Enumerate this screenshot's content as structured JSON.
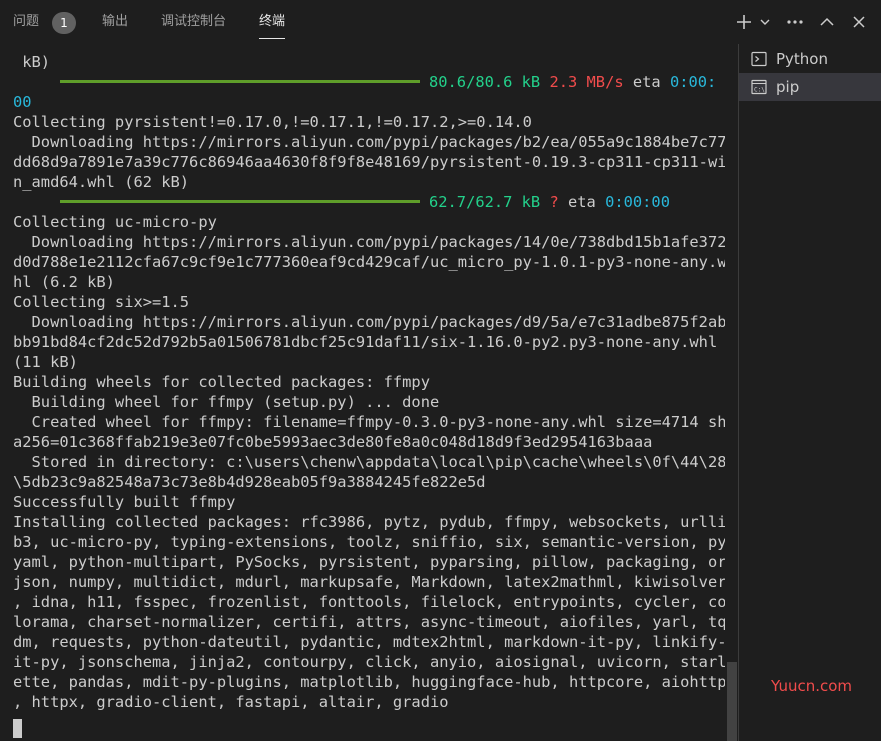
{
  "tabs": [
    {
      "label": "问题"
    },
    {
      "label": "输出"
    },
    {
      "label": "调试控制台"
    },
    {
      "label": "终端"
    }
  ],
  "problems_count": "1",
  "header_icons": {
    "new_terminal": "plus-icon",
    "dropdown": "chevron-down-icon",
    "more": "ellipsis-icon",
    "maximize": "chevron-up-icon",
    "close": "close-icon"
  },
  "terminal_lines": [
    {
      "segments": [
        {
          "text": " kB)"
        }
      ]
    },
    {
      "bar": true,
      "segments": [
        {
          "text": "80.6/80.6 kB ",
          "color": "green"
        },
        {
          "text": "2.3 MB/s",
          "color": "red"
        },
        {
          "text": " eta "
        },
        {
          "text": "0:00:",
          "color": "cyan"
        }
      ]
    },
    {
      "segments": [
        {
          "text": "00",
          "color": "cyan"
        }
      ]
    },
    {
      "segments": [
        {
          "text": "Collecting pyrsistent!=0.17.0,!=0.17.1,!=0.17.2,>=0.14.0"
        }
      ]
    },
    {
      "segments": [
        {
          "text": "  Downloading https://mirrors.aliyun.com/pypi/packages/b2/ea/055a9c1884be7c77"
        }
      ]
    },
    {
      "segments": [
        {
          "text": "dd68d9a7891e7a39c776c86946aa4630f8f9f8e48169/pyrsistent-0.19.3-cp311-cp311-wi"
        }
      ]
    },
    {
      "segments": [
        {
          "text": "n_amd64.whl (62 kB)"
        }
      ]
    },
    {
      "bar": true,
      "segments": [
        {
          "text": "62.7/62.7 kB ",
          "color": "green"
        },
        {
          "text": "?",
          "color": "red"
        },
        {
          "text": " eta "
        },
        {
          "text": "0:00:00",
          "color": "cyan"
        }
      ]
    },
    {
      "segments": [
        {
          "text": "Collecting uc-micro-py"
        }
      ]
    },
    {
      "segments": [
        {
          "text": "  Downloading https://mirrors.aliyun.com/pypi/packages/14/0e/738dbd15b1afe372"
        }
      ]
    },
    {
      "segments": [
        {
          "text": "d0d788e1e2112cfa67c9cf9e1c777360eaf9cd429caf/uc_micro_py-1.0.1-py3-none-any.w"
        }
      ]
    },
    {
      "segments": [
        {
          "text": "hl (6.2 kB)"
        }
      ]
    },
    {
      "segments": [
        {
          "text": "Collecting six>=1.5"
        }
      ]
    },
    {
      "segments": [
        {
          "text": "  Downloading https://mirrors.aliyun.com/pypi/packages/d9/5a/e7c31adbe875f2ab"
        }
      ]
    },
    {
      "segments": [
        {
          "text": "bb91bd84cf2dc52d792b5a01506781dbcf25c91daf11/six-1.16.0-py2.py3-none-any.whl"
        }
      ]
    },
    {
      "segments": [
        {
          "text": "(11 kB)"
        }
      ]
    },
    {
      "segments": [
        {
          "text": "Building wheels for collected packages: ffmpy"
        }
      ]
    },
    {
      "segments": [
        {
          "text": "  Building wheel for ffmpy (setup.py) ... done"
        }
      ]
    },
    {
      "segments": [
        {
          "text": "  Created wheel for ffmpy: filename=ffmpy-0.3.0-py3-none-any.whl size=4714 sh"
        }
      ]
    },
    {
      "segments": [
        {
          "text": "a256=01c368ffab219e3e07fc0be5993aec3de80fe8a0c048d18d9f3ed2954163baaa"
        }
      ]
    },
    {
      "segments": [
        {
          "text": "  Stored in directory: c:\\users\\chenw\\appdata\\local\\pip\\cache\\wheels\\0f\\44\\28"
        }
      ]
    },
    {
      "segments": [
        {
          "text": "\\5db23c9a82548a73c73e8b4d928eab05f9a3884245fe822e5d"
        }
      ]
    },
    {
      "segments": [
        {
          "text": "Successfully built ffmpy"
        }
      ]
    },
    {
      "segments": [
        {
          "text": "Installing collected packages: rfc3986, pytz, pydub, ffmpy, websockets, urlli"
        }
      ]
    },
    {
      "segments": [
        {
          "text": "b3, uc-micro-py, typing-extensions, toolz, sniffio, six, semantic-version, py"
        }
      ]
    },
    {
      "segments": [
        {
          "text": "yaml, python-multipart, PySocks, pyrsistent, pyparsing, pillow, packaging, or"
        }
      ]
    },
    {
      "segments": [
        {
          "text": "json, numpy, multidict, mdurl, markupsafe, Markdown, latex2mathml, kiwisolver"
        }
      ]
    },
    {
      "segments": [
        {
          "text": ", idna, h11, fsspec, frozenlist, fonttools, filelock, entrypoints, cycler, co"
        }
      ]
    },
    {
      "segments": [
        {
          "text": "lorama, charset-normalizer, certifi, attrs, async-timeout, aiofiles, yarl, tq"
        }
      ]
    },
    {
      "segments": [
        {
          "text": "dm, requests, python-dateutil, pydantic, mdtex2html, markdown-it-py, linkify-"
        }
      ]
    },
    {
      "segments": [
        {
          "text": "it-py, jsonschema, jinja2, contourpy, click, anyio, aiosignal, uvicorn, starl"
        }
      ]
    },
    {
      "segments": [
        {
          "text": "ette, pandas, mdit-py-plugins, matplotlib, huggingface-hub, httpcore, aiohttp"
        }
      ]
    },
    {
      "segments": [
        {
          "text": ", httpx, gradio-client, fastapi, altair, gradio"
        }
      ]
    }
  ],
  "terminal_list": [
    {
      "label": "Python",
      "icon": "terminal-icon"
    },
    {
      "label": "pip",
      "icon": "cmd-icon"
    }
  ],
  "watermark": "Yuucn.com",
  "colors": {
    "background": "#1e1e1e",
    "text": "#cccccc",
    "green": "#23d18b",
    "red": "#f14c4c",
    "cyan": "#29b8db",
    "progress_bar": "#5f9e2a",
    "selected_item": "#37373d"
  }
}
